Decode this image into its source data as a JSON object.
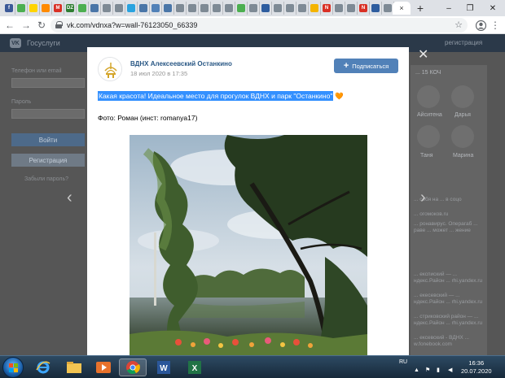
{
  "browser": {
    "active_tab_close": "×",
    "new_tab": "+",
    "window_controls": {
      "minimize": "–",
      "restore": "❐",
      "close": "✕"
    },
    "address_bar": {
      "url": "vk.com/vdnxa?w=wall-76123050_66339"
    },
    "nav": {
      "back": "←",
      "forward": "→",
      "reload": "↻"
    },
    "tab_favicons": [
      {
        "icon": "facebook-icon",
        "color": "#3b5998",
        "glyph": "f"
      },
      {
        "icon": "flag-icon",
        "color": "#4caf50",
        "glyph": ""
      },
      {
        "icon": "flag-icon",
        "color": "#ffd400",
        "glyph": ""
      },
      {
        "icon": "mail-icon",
        "color": "#ff8a00",
        "glyph": ""
      },
      {
        "icon": "letter-m-icon",
        "color": "#d93025",
        "glyph": "M"
      },
      {
        "icon": "dzen-icon",
        "color": "#2e7d32",
        "glyph": "DZ"
      },
      {
        "icon": "image-icon",
        "color": "#4caf50",
        "glyph": ""
      },
      {
        "icon": "vk-icon",
        "color": "#4a76a8",
        "glyph": ""
      },
      {
        "icon": "globe-icon",
        "color": "#7e8a95",
        "glyph": ""
      },
      {
        "icon": "globe-icon",
        "color": "#7e8a95",
        "glyph": ""
      },
      {
        "icon": "telegram-icon",
        "color": "#2aa3df",
        "glyph": ""
      },
      {
        "icon": "vk-icon",
        "color": "#4a76a8",
        "glyph": ""
      },
      {
        "icon": "doc-icon",
        "color": "#5181b8",
        "glyph": ""
      },
      {
        "icon": "vk-icon",
        "color": "#4a76a8",
        "glyph": ""
      },
      {
        "icon": "globe-icon",
        "color": "#7e8a95",
        "glyph": ""
      },
      {
        "icon": "globe-icon",
        "color": "#7e8a95",
        "glyph": ""
      },
      {
        "icon": "globe-icon",
        "color": "#7e8a95",
        "glyph": ""
      },
      {
        "icon": "globe-icon",
        "color": "#7e8a95",
        "glyph": ""
      },
      {
        "icon": "globe-icon",
        "color": "#7e8a95",
        "glyph": ""
      },
      {
        "icon": "doc-icon",
        "color": "#4caf50",
        "glyph": ""
      },
      {
        "icon": "globe-icon",
        "color": "#7e8a95",
        "glyph": ""
      },
      {
        "icon": "shield-icon",
        "color": "#2e5d9f",
        "glyph": ""
      },
      {
        "icon": "globe-icon",
        "color": "#7e8a95",
        "glyph": ""
      },
      {
        "icon": "globe-icon",
        "color": "#7e8a95",
        "glyph": ""
      },
      {
        "icon": "globe-icon",
        "color": "#7e8a95",
        "glyph": ""
      },
      {
        "icon": "star-icon",
        "color": "#f4b400",
        "glyph": ""
      },
      {
        "icon": "letter-n-icon",
        "color": "#d93025",
        "glyph": "N"
      },
      {
        "icon": "globe-icon",
        "color": "#7e8a95",
        "glyph": ""
      },
      {
        "icon": "globe-icon",
        "color": "#7e8a95",
        "glyph": ""
      },
      {
        "icon": "letter-n-icon",
        "color": "#d93025",
        "glyph": "N"
      },
      {
        "icon": "shield-icon",
        "color": "#2e5d9f",
        "glyph": ""
      },
      {
        "icon": "globe-icon",
        "color": "#7e8a95",
        "glyph": ""
      }
    ]
  },
  "vk_background": {
    "brand": "Госуслуги",
    "register_link": "регистрация",
    "phone_label": "Телефон или email",
    "password_label": "Пароль",
    "login_button": "Войти",
    "register_button": "Регистрация",
    "forgot_link": "Забыли пароль?",
    "followers_label": "... 15 КОЧ",
    "people": [
      "Айситена",
      "Дарья",
      "Таня",
      "Марина"
    ],
    "news": [
      "... себя на ... в соцо",
      "... огомоков.ru",
      "... ронавирус. Операгаб ... раве ... может ... жение",
      "... експиский — ... ндекс.Район ... rhi.yandex.ru",
      "... екесевский — ... ндекс.Район ... rhi.yandex.ru",
      "... стриковский район — ... ндекс.Район ... rhi.yandex.ru",
      "... ексевский - ВДНХ ... w.fonebook.com"
    ]
  },
  "modal": {
    "close": "✕",
    "publisher": "ВДНХ Алексеевский Останкино",
    "date": "18 июл 2020 в 17:35",
    "subscribe_label": "Подписаться",
    "subscribe_icon": "+",
    "post_text": "Какая красота! Идеальное место для прогулок ВДНХ и парк \"Останкино\"",
    "heart": "🧡",
    "photo_credit": "Фото: Роман (инст: romanya17)",
    "prev": "‹",
    "next": "›"
  },
  "taskbar": {
    "language": "RU",
    "time": "16:36",
    "date": "20.07.2020"
  }
}
